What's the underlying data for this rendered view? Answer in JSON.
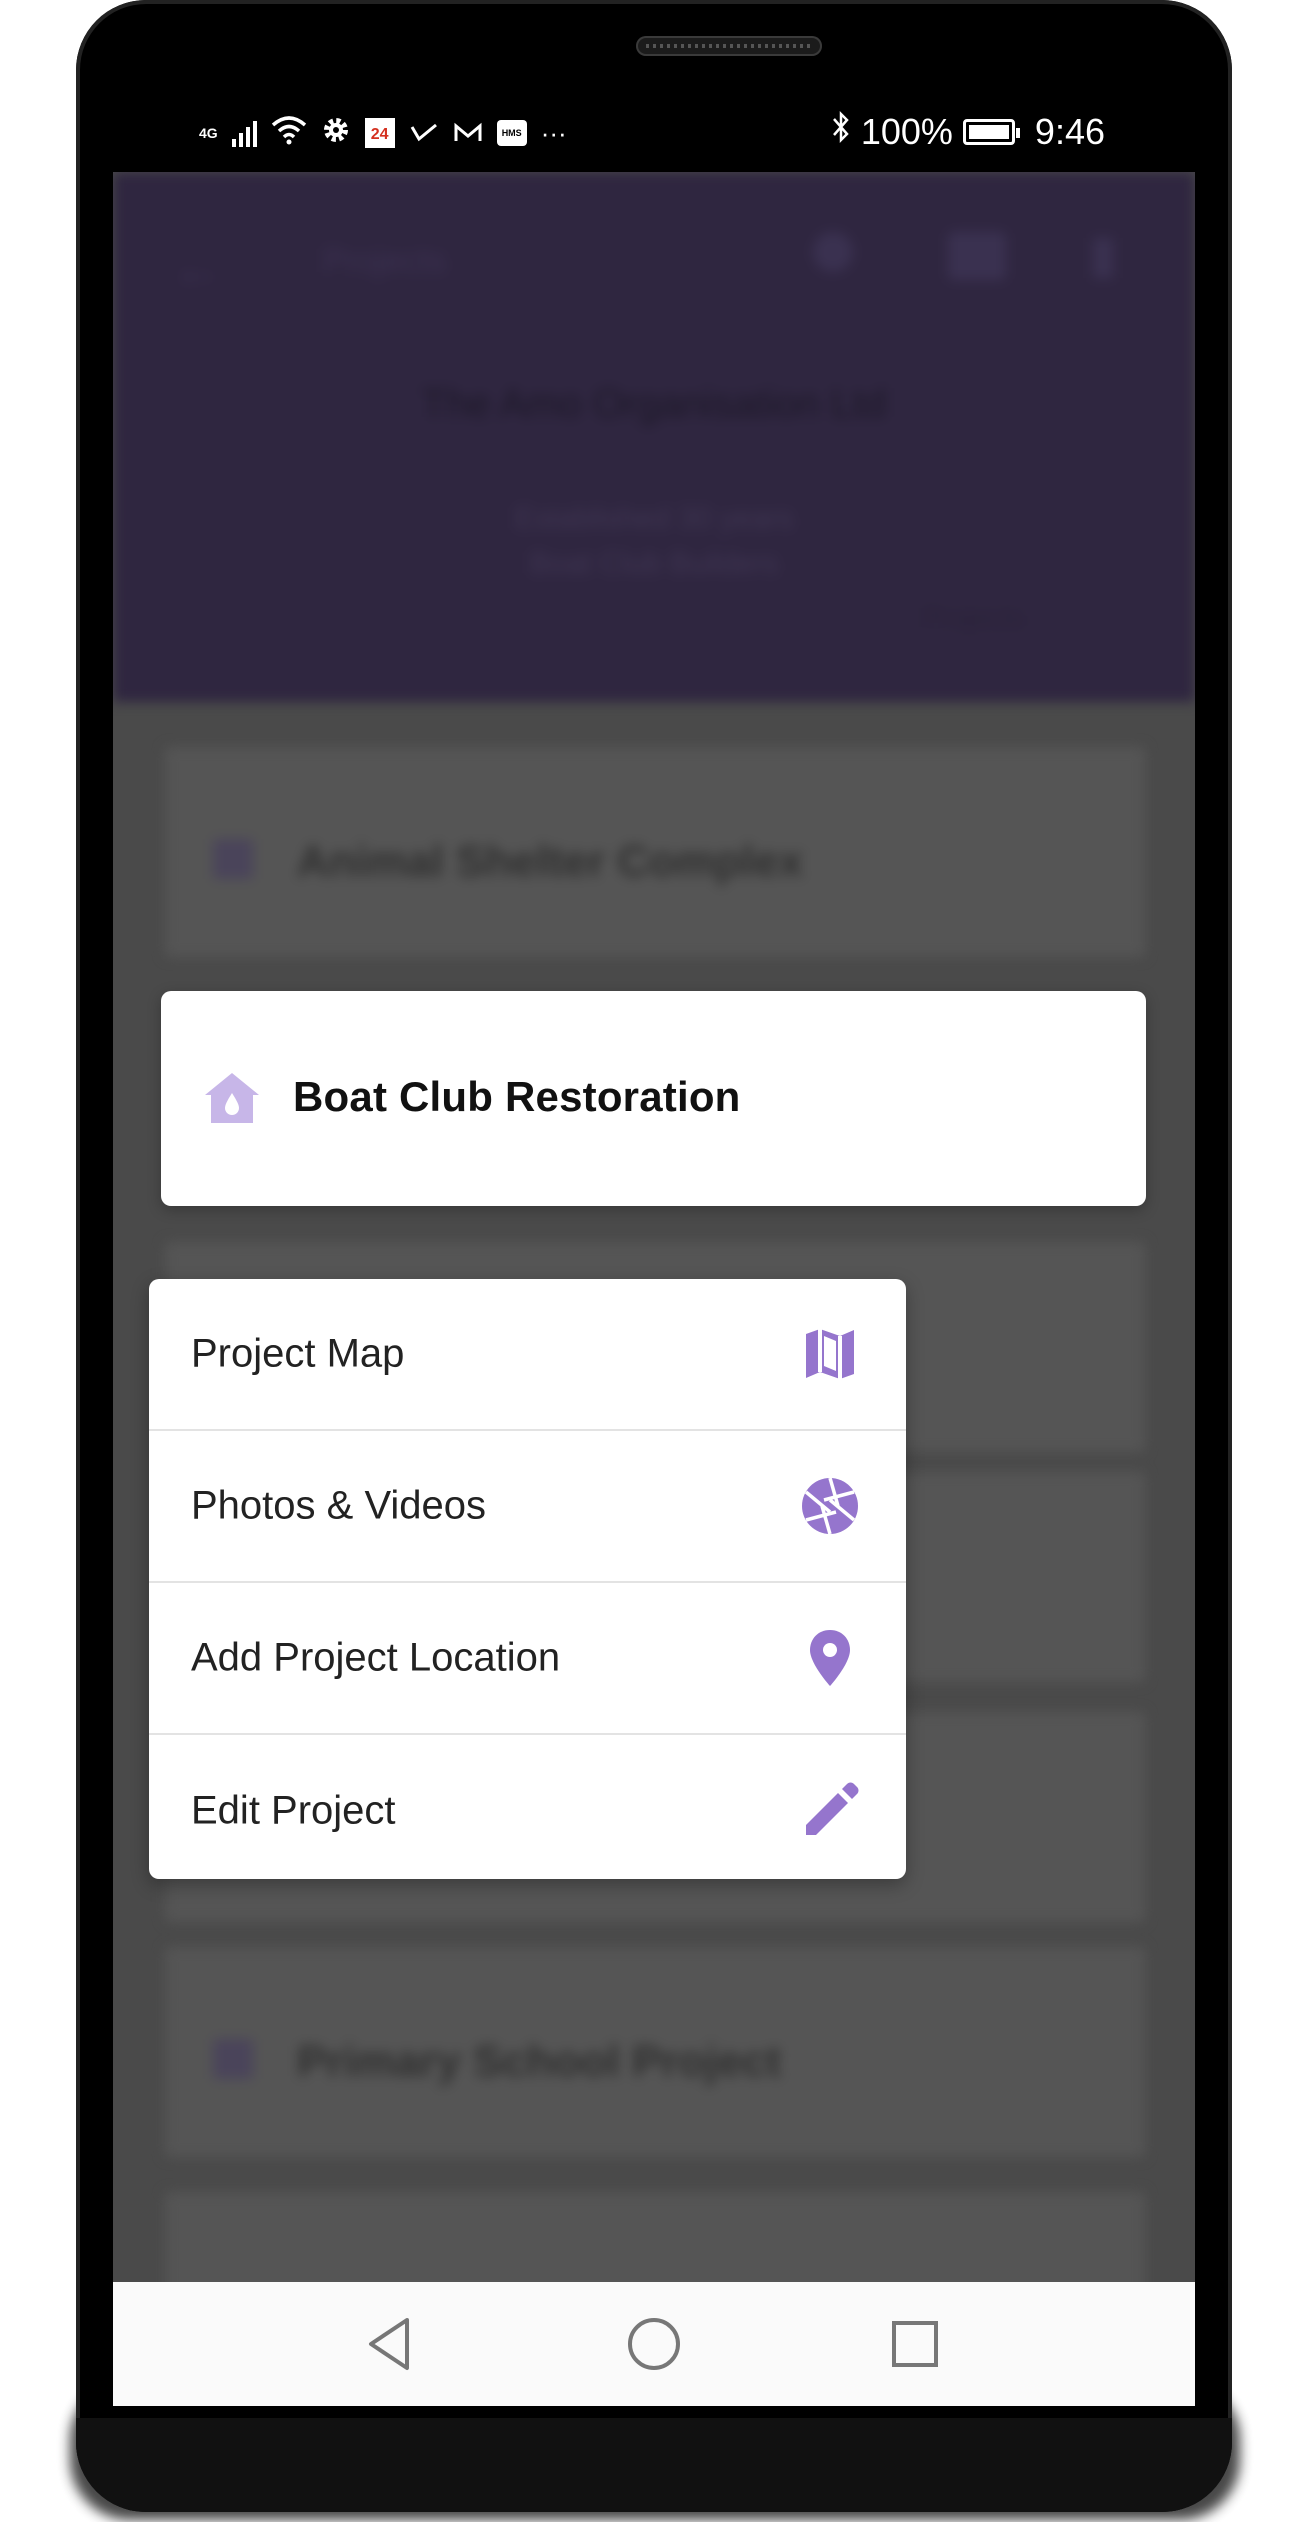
{
  "status_bar": {
    "network_type": "4G",
    "calendar_day": "24",
    "hms_label": "HMS",
    "overflow": "···",
    "battery_percent": "100%",
    "time": "9:46"
  },
  "background": {
    "header_title": "Projects",
    "organisation": "The Amo Organisation Ltd",
    "line1": "Established 30 years",
    "line2": "Boat Club Builders",
    "filter_label": "Projects"
  },
  "background_projects": [
    "Animal Shelter Complex",
    "Primary School Project"
  ],
  "selected_project": {
    "title": "Boat Club Restoration"
  },
  "menu": {
    "items": [
      {
        "label": "Project Map",
        "icon": "map-icon"
      },
      {
        "label": "Photos & Videos",
        "icon": "camera-aperture-icon"
      },
      {
        "label": "Add Project Location",
        "icon": "location-pin-icon"
      },
      {
        "label": "Edit Project",
        "icon": "pencil-icon"
      }
    ]
  },
  "colors": {
    "accent": "#9575cd",
    "accent_light": "#c7b6e8",
    "header": "#2f2640",
    "dim_background": "#4a4a4a"
  }
}
